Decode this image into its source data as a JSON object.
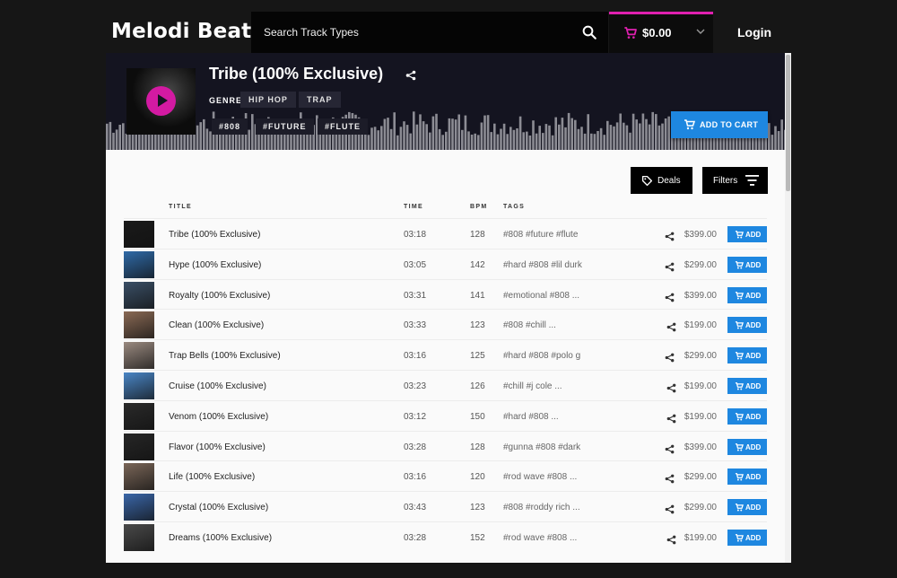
{
  "header": {
    "logo": "Melodi Beats",
    "search_placeholder": "Search Track Types",
    "cart_total": "$0.00",
    "login_label": "Login",
    "accent_color": "#e020b0"
  },
  "hero": {
    "title": "Tribe (100% Exclusive)",
    "genre_label": "GENRE",
    "genres": [
      "HIP HOP",
      "TRAP"
    ],
    "tags": [
      "#808",
      "#FUTURE",
      "#FLUTE"
    ],
    "add_to_cart_label": "ADD TO CART"
  },
  "toolbar": {
    "deals_label": "Deals",
    "filters_label": "Filters"
  },
  "columns": {
    "title": "TITLE",
    "time": "TIME",
    "bpm": "BPM",
    "tags": "TAGS"
  },
  "add_label": "ADD",
  "tracks": [
    {
      "title": "Tribe (100% Exclusive)",
      "time": "03:18",
      "bpm": "128",
      "tags": "#808 #future #flute",
      "price": "$399.00",
      "thumb": "#1a1a1a"
    },
    {
      "title": "Hype (100% Exclusive)",
      "time": "03:05",
      "bpm": "142",
      "tags": "#hard #808 #lil durk",
      "price": "$299.00",
      "thumb": "#2f6aa8"
    },
    {
      "title": "Royalty (100% Exclusive)",
      "time": "03:31",
      "bpm": "141",
      "tags": "#emotional #808 ...",
      "price": "$399.00",
      "thumb": "#3a4f66"
    },
    {
      "title": "Clean (100% Exclusive)",
      "time": "03:33",
      "bpm": "123",
      "tags": "#808 #chill ...",
      "price": "$199.00",
      "thumb": "#8a6a55"
    },
    {
      "title": "Trap Bells (100% Exclusive)",
      "time": "03:16",
      "bpm": "125",
      "tags": "#hard #808 #polo g",
      "price": "$299.00",
      "thumb": "#9a8a80"
    },
    {
      "title": "Cruise (100% Exclusive)",
      "time": "03:23",
      "bpm": "126",
      "tags": "#chill #j cole ...",
      "price": "$199.00",
      "thumb": "#4a86c6"
    },
    {
      "title": "Venom (100% Exclusive)",
      "time": "03:12",
      "bpm": "150",
      "tags": "#hard #808 ...",
      "price": "$199.00",
      "thumb": "#2a2a2a"
    },
    {
      "title": "Flavor (100% Exclusive)",
      "time": "03:28",
      "bpm": "128",
      "tags": "#gunna #808 #dark",
      "price": "$399.00",
      "thumb": "#262626"
    },
    {
      "title": "Life (100% Exclusive)",
      "time": "03:16",
      "bpm": "120",
      "tags": "#rod wave #808 ...",
      "price": "$299.00",
      "thumb": "#7a6658"
    },
    {
      "title": "Crystal (100% Exclusive)",
      "time": "03:43",
      "bpm": "123",
      "tags": "#808 #roddy rich ...",
      "price": "$299.00",
      "thumb": "#3a66a8"
    },
    {
      "title": "Dreams (100% Exclusive)",
      "time": "03:28",
      "bpm": "152",
      "tags": "#rod wave #808 ...",
      "price": "$199.00",
      "thumb": "#4a4a4a"
    }
  ]
}
